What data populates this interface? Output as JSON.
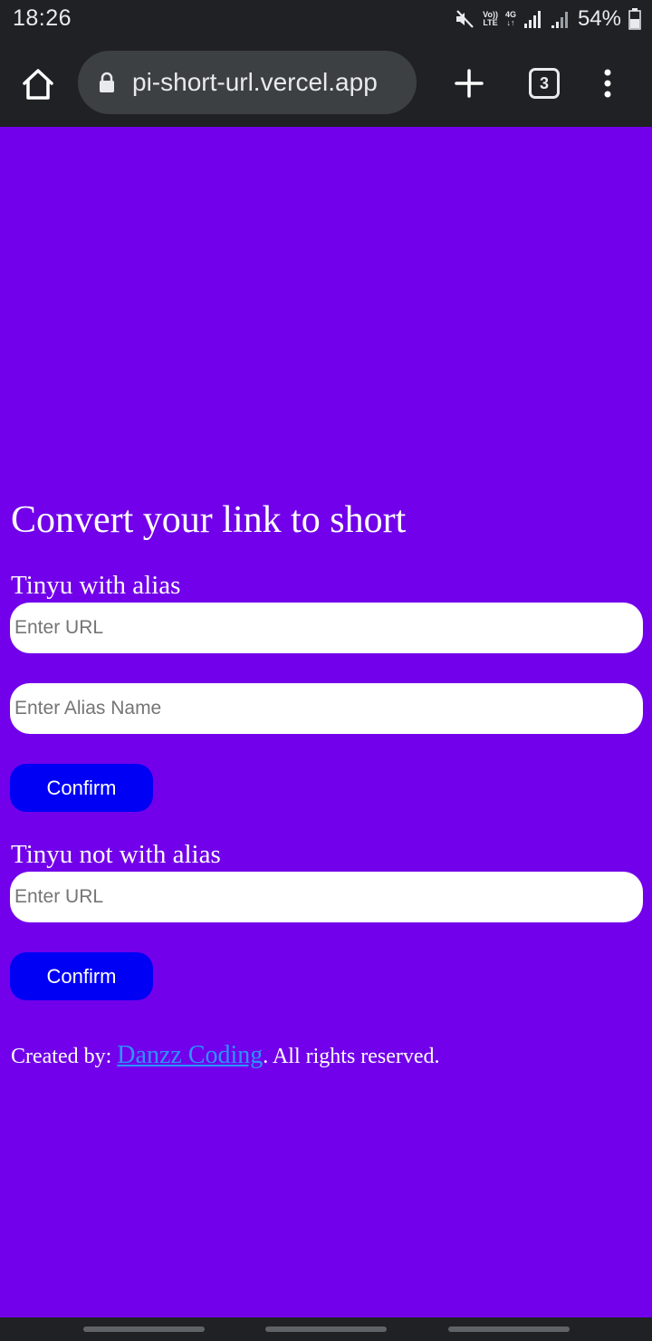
{
  "status_bar": {
    "time": "18:26",
    "volte_top": "Vo))",
    "volte_bottom": "LTE",
    "network": "4G",
    "battery": "54%",
    "icons": [
      "mute-icon",
      "signal-icon",
      "signal-icon",
      "battery-icon"
    ]
  },
  "browser": {
    "url": "pi-short-url.vercel.app",
    "tab_count": "3",
    "icons": [
      "home-icon",
      "lock-icon",
      "plus-icon",
      "tabs-icon",
      "more-vertical-icon"
    ]
  },
  "page": {
    "title": "Convert your link to short",
    "with_alias": {
      "label": "Tinyu with alias",
      "url_placeholder": "Enter URL",
      "alias_placeholder": "Enter Alias Name",
      "confirm_label": "Confirm"
    },
    "without_alias": {
      "label": "Tinyu not with alias",
      "url_placeholder": "Enter URL",
      "confirm_label": "Confirm"
    },
    "footer": {
      "prefix": "Created by: ",
      "link_text": "Danzz Coding",
      "suffix": ". All rights reserved."
    }
  },
  "colors": {
    "page_background": "#7200ea",
    "button": "#0000f5",
    "link": "#2a95ff",
    "chrome": "#202124"
  }
}
